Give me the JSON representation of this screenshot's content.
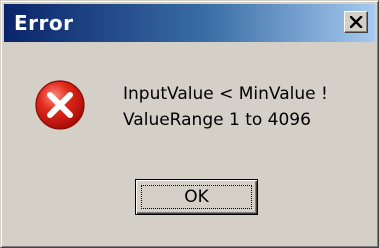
{
  "window": {
    "title": "Error",
    "close_icon": "close-icon"
  },
  "message": {
    "icon": "error-icon",
    "line1": "InputValue < MinValue !",
    "line2": "ValueRange 1 to 4096"
  },
  "buttons": {
    "ok_label": "OK"
  },
  "colors": {
    "titlebar_start": "#0a246a",
    "titlebar_end": "#a6caf0",
    "dialog_bg": "#d4d0c8",
    "error_red": "#d4221a"
  }
}
